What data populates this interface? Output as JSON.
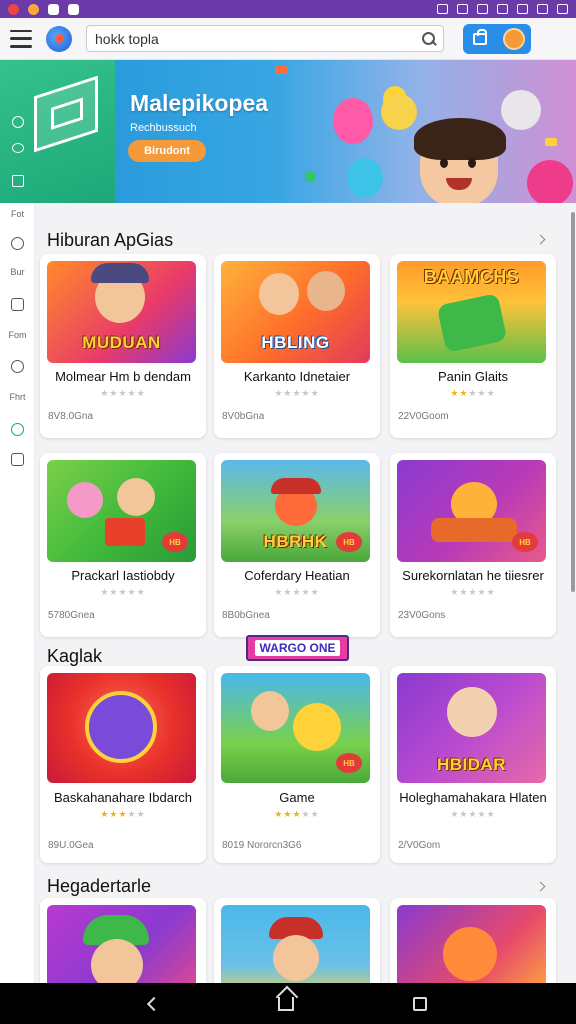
{
  "app": {
    "search_text": "hokk topla",
    "banner_title": "Malepikopea",
    "banner_subtitle": "Rechbussuch",
    "banner_button": "Birudont",
    "accent_color": "#2a8de8",
    "banner_green": "#22b07e",
    "status_bar_color": "#6a3aa8"
  },
  "rail": {
    "items": [
      {
        "label": "Fot",
        "icon": "text-label"
      },
      {
        "label": "",
        "icon": "compass-icon"
      },
      {
        "label": "Bur",
        "icon": "text-label"
      },
      {
        "label": "",
        "icon": "home-icon"
      },
      {
        "label": "Fom",
        "icon": "text-label"
      },
      {
        "label": "",
        "icon": "rocket-icon"
      },
      {
        "label": "Fhrt",
        "icon": "text-label"
      },
      {
        "label": "",
        "icon": "shield-icon"
      },
      {
        "label": "",
        "icon": "window-icon"
      }
    ]
  },
  "sections": [
    {
      "title": "Hiburan ApGias",
      "cards": [
        {
          "title": "Molmear Hm b dendam",
          "thumb_word": "MUDUAN",
          "stars": 0,
          "size": "8V8.0Gna"
        },
        {
          "title": "Karkanto Idnetaier",
          "thumb_word": "HBLING",
          "stars": 0,
          "size": "8V0bGna"
        },
        {
          "title": "Panin Glaits",
          "thumb_word": "BAAMCHS",
          "stars": 2,
          "size": "22V0Goom"
        },
        {
          "title": "Prackarl Iastiobdy",
          "thumb_word": "",
          "stars": 0,
          "size": "5780Gnea"
        },
        {
          "title": "Coferdary Heatian",
          "thumb_word": "HBRHK",
          "stars": 0,
          "size": "8B0bGnea"
        },
        {
          "title": "Surekornlatan he tiiesrer",
          "thumb_word": "",
          "stars": 0,
          "size": "23V0Gons"
        }
      ]
    },
    {
      "title": "Kaglak",
      "cards": [
        {
          "title": "Baskahanahare Ibdarch",
          "thumb_word": "",
          "stars": 3,
          "size": "89U.0Gea"
        },
        {
          "title": "Game",
          "thumb_word": "",
          "stars": 3,
          "size": "8019 Nororcn3G6"
        },
        {
          "title": "Holeghamahakara Hlaten",
          "thumb_word": "HBIDAR",
          "stars": 0,
          "size": "2/V0Gom"
        }
      ]
    },
    {
      "title": "Hegadertarle",
      "cards": [
        {
          "title": "",
          "thumb_word": "",
          "stars": 0,
          "size": ""
        },
        {
          "title": "",
          "thumb_word": "",
          "stars": 0,
          "size": ""
        },
        {
          "title": "",
          "thumb_word": "",
          "stars": 0,
          "size": ""
        }
      ]
    }
  ],
  "overlay_tag": "WARGO ONE"
}
